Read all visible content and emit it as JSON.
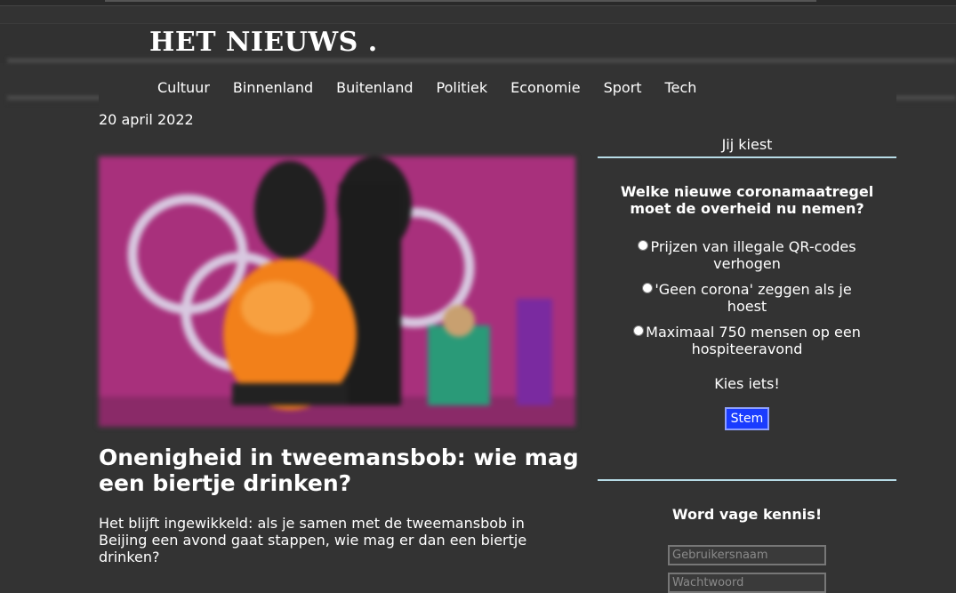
{
  "site": {
    "logo": "HET NIEUWS ."
  },
  "nav": {
    "items": [
      "Cultuur",
      "Binnenland",
      "Buitenland",
      "Politiek",
      "Economie",
      "Sport",
      "Tech"
    ]
  },
  "article": {
    "date": "20 april 2022",
    "headline": "Onenigheid in tweemansbob: wie mag een biertje drinken?",
    "lead": "Het blijft ingewikkeld: als je samen met de tweemansbob in Beijing een avond gaat stappen, wie mag er dan een biertje drinken?"
  },
  "poll": {
    "title": "Jij kiest",
    "question": "Welke nieuwe coronamaatregel moet de overheid nu nemen?",
    "options": [
      "Prijzen van illegale QR-codes verhogen",
      "'Geen corona' zeggen als je hoest",
      "Maximaal 750 mensen op een hospiteeravond"
    ],
    "prompt": "Kies iets!",
    "button": "Stem"
  },
  "login": {
    "title": "Word vage kennis!",
    "username_placeholder": "Gebruikersnaam",
    "password_placeholder": "Wachtwoord"
  },
  "colors": {
    "background": "#333333",
    "rule": "#b7dbe6",
    "button": "#1a3cff"
  }
}
